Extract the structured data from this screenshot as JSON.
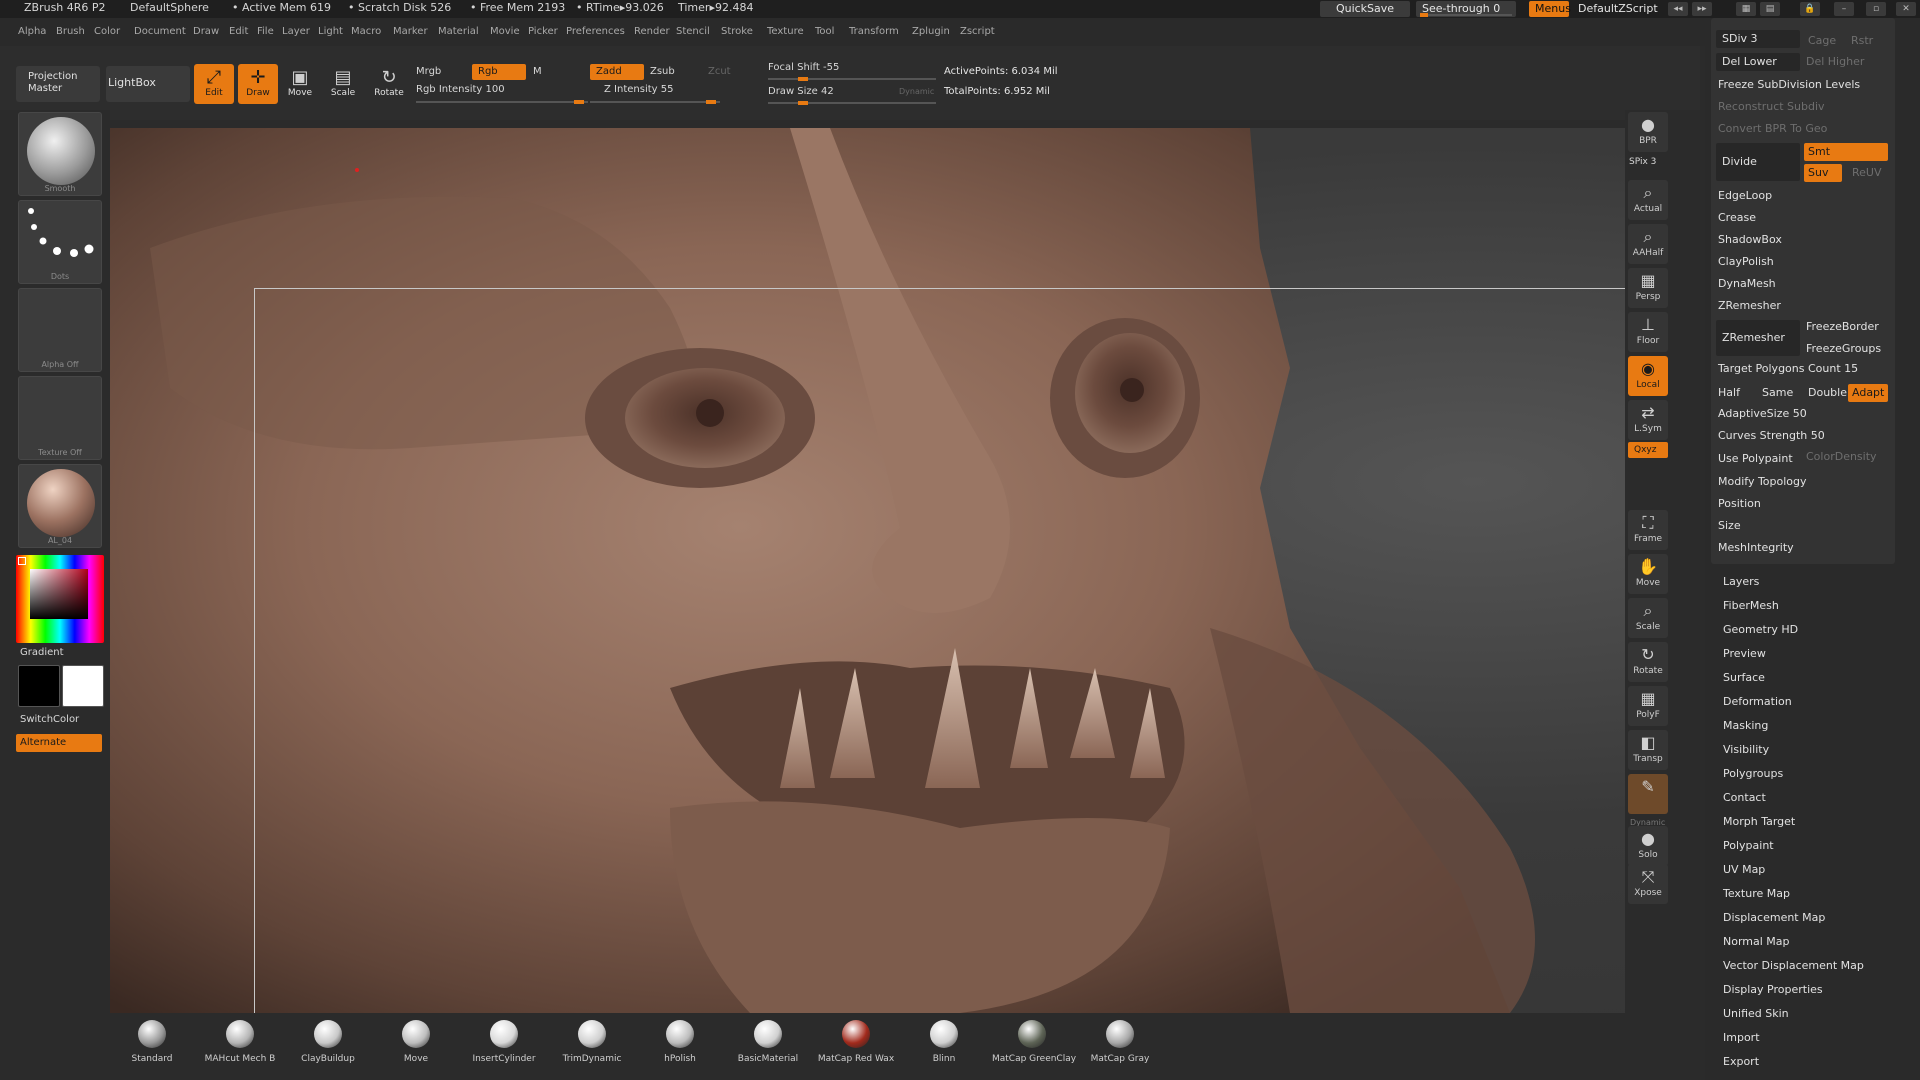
{
  "titlebar": {
    "app": "ZBrush 4R6 P2",
    "doc": "DefaultSphere",
    "active_mem": "• Active Mem 619",
    "scratch": "• Scratch Disk 526",
    "free_mem": "• Free Mem 2193",
    "rtime": "• RTime▸93.026",
    "timer": "Timer▸92.484",
    "quicksave": "QuickSave",
    "seethrough": "See-through  0",
    "menus": "Menus",
    "script": "DefaultZScript"
  },
  "menubar": [
    "Alpha",
    "Brush",
    "Color",
    "Document",
    "Draw",
    "Edit",
    "File",
    "Layer",
    "Light",
    "Macro",
    "Marker",
    "Material",
    "Movie",
    "Picker",
    "Preferences",
    "Render",
    "Stencil",
    "Stroke",
    "Texture",
    "Tool",
    "Transform",
    "Zplugin",
    "Zscript"
  ],
  "shelf": {
    "projection_master": "Projection Master",
    "lightbox": "LightBox",
    "edit": "Edit",
    "draw": "Draw",
    "move": "Move",
    "scale": "Scale",
    "rotate": "Rotate",
    "mrgb": "Mrgb",
    "rgb": "Rgb",
    "m": "M",
    "rgb_intensity": "Rgb Intensity 100",
    "zadd": "Zadd",
    "zsub": "Zsub",
    "zcut": "Zcut",
    "z_intensity": "Z Intensity 55",
    "focal_shift": "Focal Shift -55",
    "draw_size": "Draw Size 42",
    "dynamic": "Dynamic",
    "active_points": "ActivePoints: 6.034 Mil",
    "total_points": "TotalPoints: 6.952 Mil"
  },
  "lefttray": {
    "brush_cap": "Smooth",
    "stroke_cap": "Dots",
    "alpha_cap": "Alpha  Off",
    "texture_cap": "Texture  Off",
    "material_cap": "AL_04",
    "gradient": "Gradient",
    "switchcolor": "SwitchColor",
    "alternate": "Alternate"
  },
  "rightstrip": {
    "bpr": "BPR",
    "spix": "SPix 3",
    "actual": "Actual",
    "aahalf": "AAHalf",
    "persp": "Persp",
    "floor": "Floor",
    "local": "Local",
    "lsym": "L.Sym",
    "xyz": "Qxyz",
    "frame": "Frame",
    "move": "Move",
    "scale": "Scale",
    "rotate": "Rotate",
    "polyf": "PolyF",
    "transp": "Transp",
    "ghost": "Dynamic",
    "solo": "Solo",
    "xpose": "Xpose"
  },
  "geometry": {
    "sdiv": "SDiv 3",
    "cage": "Cage",
    "rstr": "Rstr",
    "del_lower": "Del Lower",
    "del_higher": "Del Higher",
    "freeze": "Freeze SubDivision Levels",
    "reconstruct": "Reconstruct Subdiv",
    "convert_bpr": "Convert BPR To Geo",
    "divide": "Divide",
    "smt": "Smt",
    "suv": "Suv",
    "reuv": "ReUV",
    "edgeloop": "EdgeLoop",
    "crease": "Crease",
    "shadowbox": "ShadowBox",
    "claypolish": "ClayPolish",
    "dynamesh": "DynaMesh",
    "zremesher_header": "ZRemesher",
    "zremesher_btn": "ZRemesher",
    "freeze_border": "FreezeBorder",
    "freeze_groups": "FreezeGroups",
    "target_polys": "Target Polygons Count 15",
    "half": "Half",
    "same": "Same",
    "double": "Double",
    "adapt": "Adapt",
    "adaptive_size": "AdaptiveSize 50",
    "curves_strength": "Curves Strength 50",
    "use_polypaint": "Use Polypaint",
    "color_density": "ColorDensity",
    "modify_topology": "Modify Topology",
    "position": "Position",
    "size": "Size",
    "mesh_integrity": "MeshIntegrity"
  },
  "subpalettes": [
    "Layers",
    "FiberMesh",
    "Geometry HD",
    "Preview",
    "Surface",
    "Deformation",
    "Masking",
    "Visibility",
    "Polygroups",
    "Contact",
    "Morph Target",
    "Polypaint",
    "UV Map",
    "Texture Map",
    "Displacement Map",
    "Normal Map",
    "Vector Displacement Map",
    "Display Properties",
    "Unified Skin",
    "Import",
    "Export"
  ],
  "brushes": [
    {
      "label": "Standard",
      "color": "#9a9a9a"
    },
    {
      "label": "MAHcut  Mech  B",
      "color": "#b5b5b5"
    },
    {
      "label": "ClayBuildup",
      "color": "#c8c8c8"
    },
    {
      "label": "Move",
      "color": "#bdbdbd"
    },
    {
      "label": "InsertCylinder",
      "color": "#d8d8d8"
    },
    {
      "label": "TrimDynamic",
      "color": "#cfcfcf"
    },
    {
      "label": "hPolish",
      "color": "#bcbcbc"
    },
    {
      "label": "BasicMaterial",
      "color": "#d0d0d0"
    },
    {
      "label": "MatCap  Red  Wax",
      "color": "#a22a1c"
    },
    {
      "label": "Blinn",
      "color": "#cfcfcf"
    },
    {
      "label": "MatCap  GreenClay",
      "color": "#5e6456"
    },
    {
      "label": "MatCap  Gray",
      "color": "#a8a8a8"
    }
  ],
  "colors": {
    "accent": "#e87a12",
    "panel": "#2b2b2b",
    "button": "#3a3a3a",
    "skin": "#8c6a59"
  }
}
